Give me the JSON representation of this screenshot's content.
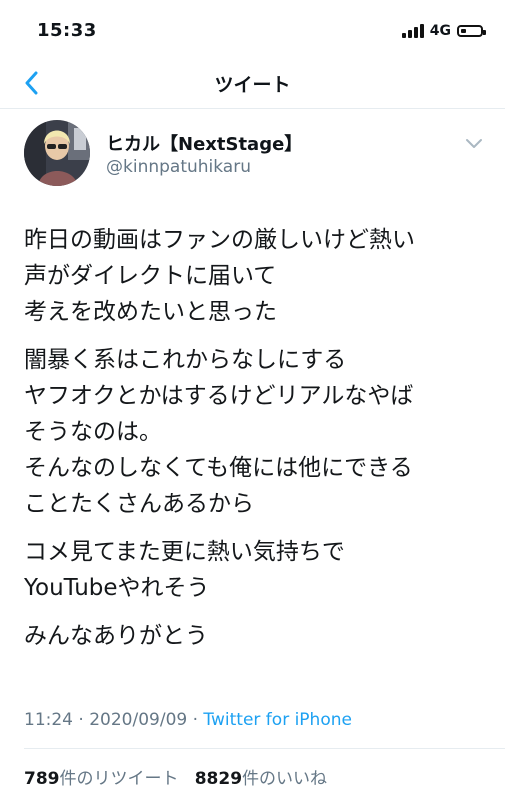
{
  "status_bar": {
    "time": "15:33",
    "network": "4G",
    "battery_level": 0.3
  },
  "nav": {
    "title": "ツイート",
    "back_icon": "chevron-left-icon",
    "accent": "#1da1f2"
  },
  "author": {
    "name": "ヒカル【NextStage】",
    "handle": "@kinnpatuhikaru"
  },
  "tweet": {
    "paragraphs": [
      "昨日の動画はファンの厳しいけど熱い\n声がダイレクトに届いて\n考えを改めたいと思った",
      "闇暴く系はこれからなしにする\nヤフオクとかはするけどリアルなやば\nそうなのは。\nそんなのしなくても俺には他にできる\nことたくさんあるから",
      "コメ見てまた更に熱い気持ちで\nYouTubeやれそう",
      "みんなありがとう"
    ],
    "time": "11:24",
    "date": "2020/09/09",
    "separator": "·",
    "source": "Twitter for iPhone"
  },
  "stats": {
    "retweets": "789",
    "retweets_label": "件のリツイート",
    "likes": "8829",
    "likes_label": "件のいいね"
  }
}
